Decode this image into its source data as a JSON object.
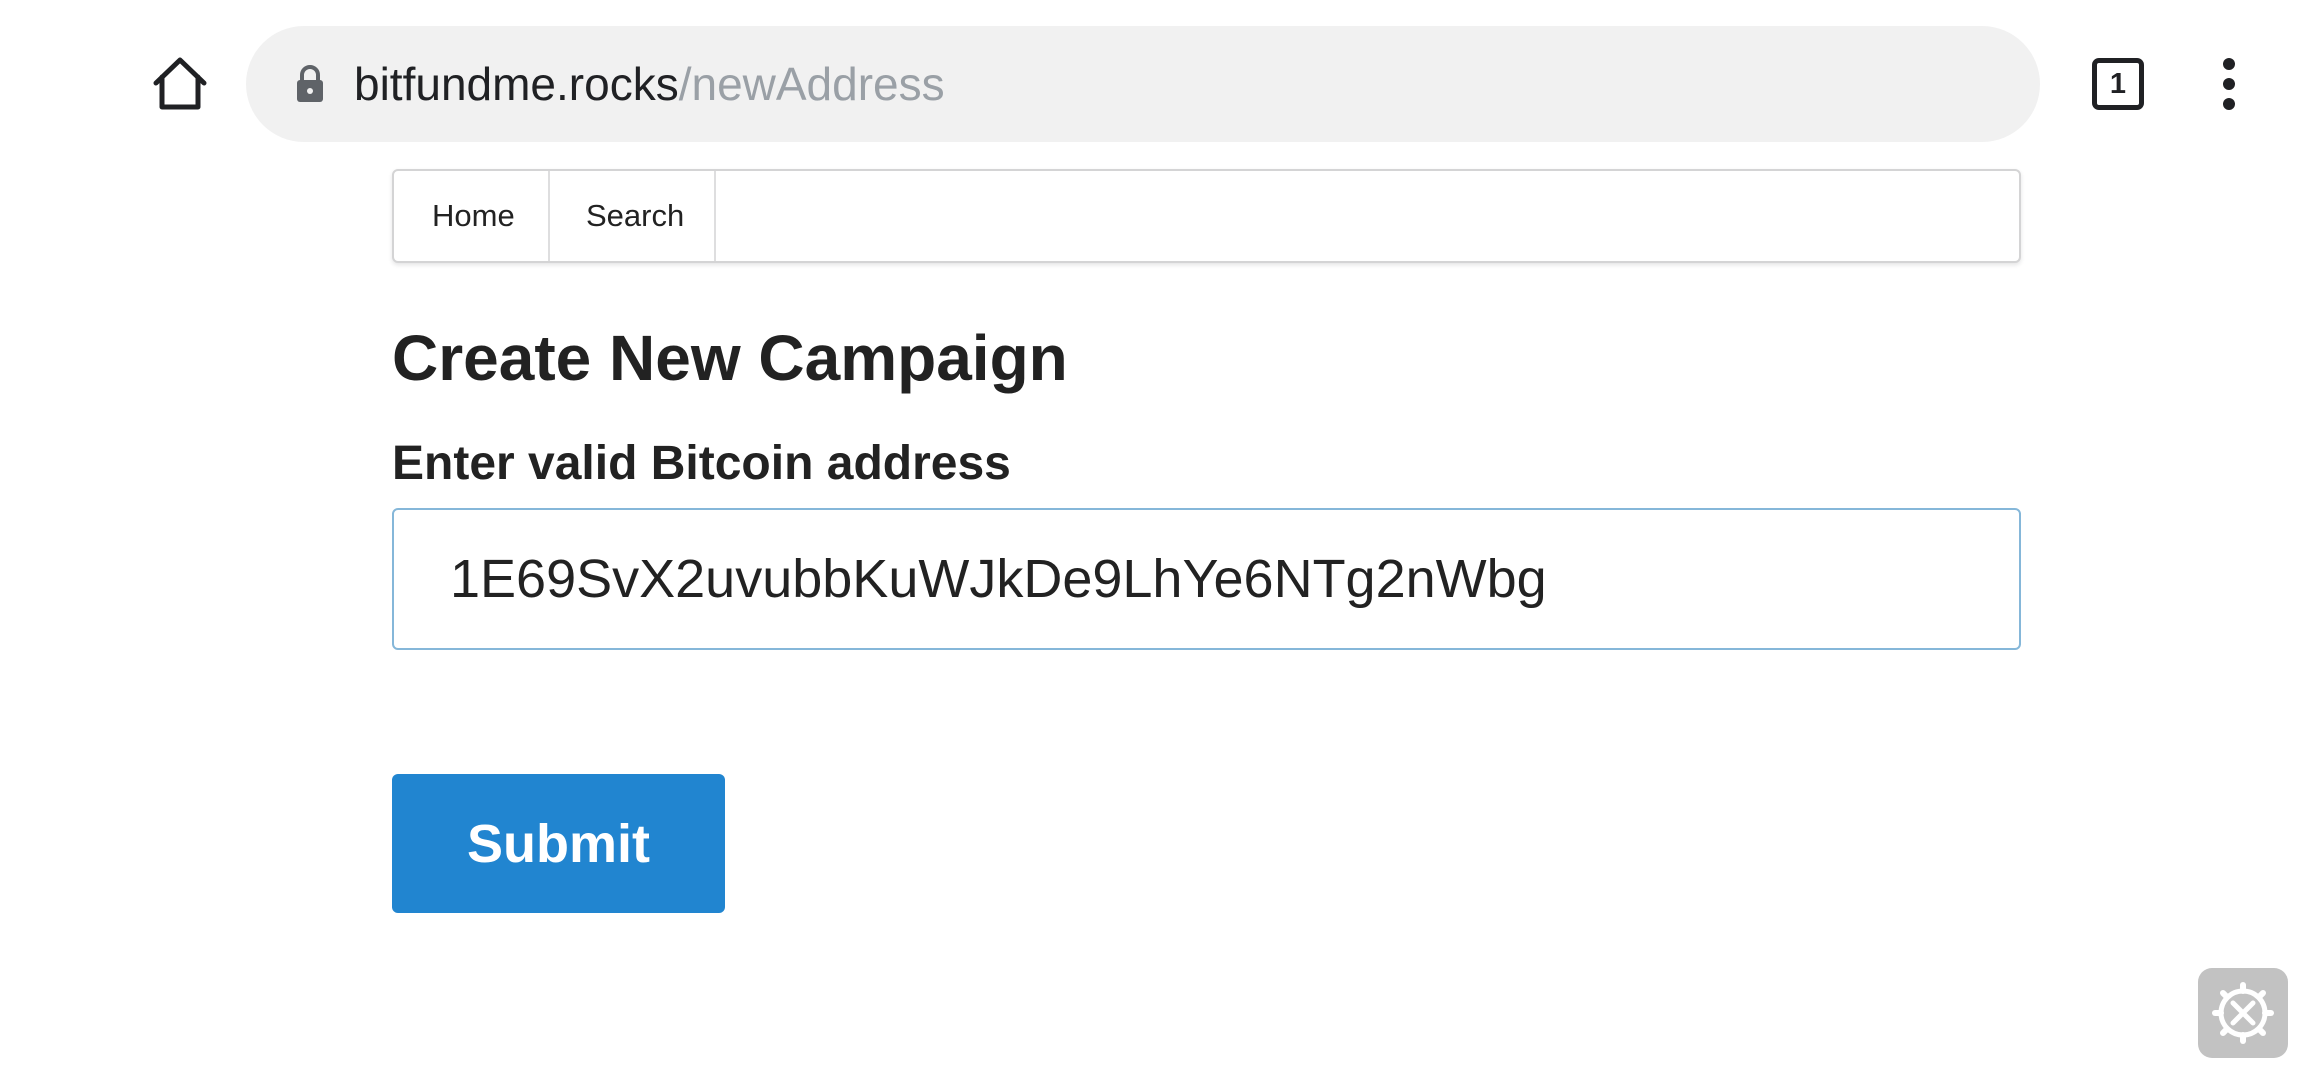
{
  "browser": {
    "icons": {
      "home": "home-icon",
      "lock": "lock-icon",
      "tabs": "tab-switcher-icon",
      "menu": "more-vert-icon"
    },
    "url_host": "bitfundme.rocks",
    "url_path": "/newAddress",
    "tab_count": "1"
  },
  "navbar": {
    "items": [
      {
        "label": "Home"
      },
      {
        "label": "Search"
      }
    ]
  },
  "page": {
    "title": "Create New Campaign",
    "address_label": "Enter valid Bitcoin address",
    "address_value": "1E69SvX2uvubbKuWJkDe9LhYe6NTg2nWbg",
    "submit_label": "Submit"
  },
  "floating_tool": {
    "icon": "settings-tools-icon"
  },
  "colors": {
    "primary_button": "#2185d0",
    "input_focus_border": "#85b7d9",
    "omnibox_bg": "#f1f1f1"
  }
}
